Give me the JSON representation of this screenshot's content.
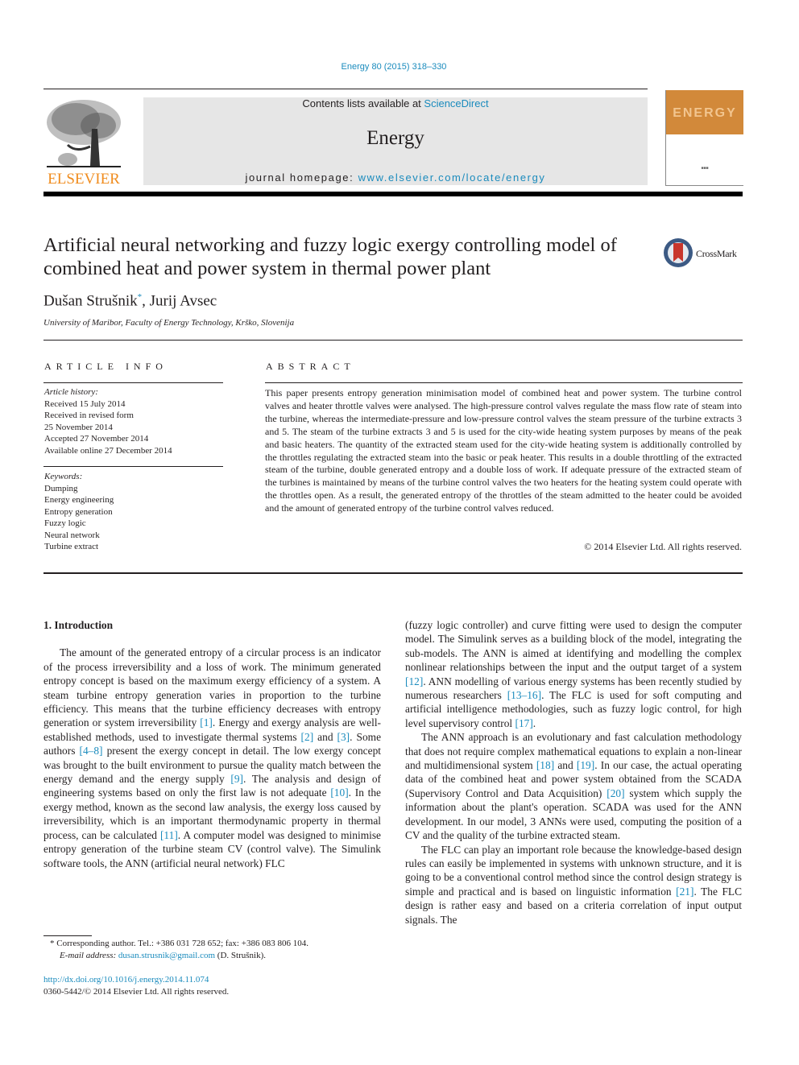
{
  "header": {
    "journal_reference": "Energy 80 (2015) 318–330",
    "publisher_logo_text": "ELSEVIER",
    "contents_prefix": "Contents lists available at ",
    "contents_link": "ScienceDirect",
    "journal_name": "Energy",
    "homepage_prefix": "journal homepage: ",
    "homepage_link": "www.elsevier.com/locate/energy",
    "cover_title": "ENERGY",
    "colors": {
      "link": "#1a8bbd",
      "elsevier_orange": "#f08c1e",
      "cover_orange": "#d2893a",
      "grey_box": "#e6e6e6"
    }
  },
  "article": {
    "title": "Artificial neural networking and fuzzy logic exergy controlling model of combined heat and power system in thermal power plant",
    "crossmark_label": "CrossMark",
    "authors": [
      {
        "name": "Dušan Strušnik",
        "mark": "*"
      },
      {
        "name": "Jurij Avsec",
        "mark": ""
      }
    ],
    "author_separator": ", ",
    "affiliation": "University of Maribor, Faculty of Energy Technology, Krško, Slovenija"
  },
  "article_info": {
    "heading": "ARTICLE INFO",
    "history_label": "Article history:",
    "history": [
      "Received 15 July 2014",
      "Received in revised form",
      "25 November 2014",
      "Accepted 27 November 2014",
      "Available online 27 December 2014"
    ],
    "keywords_label": "Keywords:",
    "keywords": [
      "Dumping",
      "Energy engineering",
      "Entropy generation",
      "Fuzzy logic",
      "Neural network",
      "Turbine extract"
    ]
  },
  "abstract": {
    "heading": "ABSTRACT",
    "text": "This paper presents entropy generation minimisation model of combined heat and power system. The turbine control valves and heater throttle valves were analysed. The high-pressure control valves regulate the mass flow rate of steam into the turbine, whereas the intermediate-pressure and low-pressure control valves the steam pressure of the turbine extracts 3 and 5. The steam of the turbine extracts 3 and 5 is used for the city-wide heating system purposes by means of the peak and basic heaters. The quantity of the extracted steam used for the city-wide heating system is additionally controlled by the throttles regulating the extracted steam into the basic or peak heater. This results in a double throttling of the extracted steam of the turbine, double generated entropy and a double loss of work. If adequate pressure of the extracted steam of the turbines is maintained by means of the turbine control valves the two heaters for the heating system could operate with the throttles open. As a result, the generated entropy of the throttles of the steam admitted to the heater could be avoided and the amount of generated entropy of the turbine control valves reduced.",
    "copyright": "© 2014 Elsevier Ltd. All rights reserved."
  },
  "introduction": {
    "heading": "1.  Introduction",
    "left_paragraphs": [
      [
        {
          "t": "The amount of the generated entropy of a circular process is an indicator of the process irreversibility and a loss of work. The minimum generated entropy concept is based on the maximum exergy efficiency of a system. A steam turbine entropy generation varies in proportion to the turbine efficiency. This means that the turbine efficiency decreases with entropy generation or system irreversibility "
        },
        {
          "ref": "[1]"
        },
        {
          "t": ". Energy and exergy analysis are well-established methods, used to investigate thermal systems "
        },
        {
          "ref": "[2]"
        },
        {
          "t": " and "
        },
        {
          "ref": "[3]"
        },
        {
          "t": ". Some authors "
        },
        {
          "ref": "[4–8]"
        },
        {
          "t": " present the exergy concept in detail. The low exergy concept was brought to the built environment to pursue the quality match between the energy demand and the energy supply "
        },
        {
          "ref": "[9]"
        },
        {
          "t": ". The analysis and design of engineering systems based on only the first law is not adequate "
        },
        {
          "ref": "[10]"
        },
        {
          "t": ". In the exergy method, known as the second law analysis, the exergy loss caused by irreversibility, which is an important thermodynamic property in thermal process, can be calculated "
        },
        {
          "ref": "[11]"
        },
        {
          "t": ". A computer model was designed to minimise entropy generation of the turbine steam CV (control valve). The Simulink software tools, the ANN (artificial neural network) FLC"
        }
      ]
    ],
    "right_paragraphs": [
      [
        {
          "t": "(fuzzy logic controller) and curve fitting were used to design the computer model. The Simulink serves as a building block of the model, integrating the sub-models. The ANN is aimed at identifying and modelling the complex nonlinear relationships between the input and the output target of a system "
        },
        {
          "ref": "[12]"
        },
        {
          "t": ". ANN modelling of various energy systems has been recently studied by numerous researchers "
        },
        {
          "ref": "[13–16]"
        },
        {
          "t": ". The FLC is used for soft computing and artificial intelligence methodologies, such as fuzzy logic control, for high level supervisory control "
        },
        {
          "ref": "[17]"
        },
        {
          "t": "."
        }
      ],
      [
        {
          "t": "The ANN approach is an evolutionary and fast calculation methodology that does not require complex mathematical equations to explain a non-linear and multidimensional system "
        },
        {
          "ref": "[18]"
        },
        {
          "t": " and "
        },
        {
          "ref": "[19]"
        },
        {
          "t": ". In our case, the actual operating data of the combined heat and power system obtained from the SCADA (Supervisory Control and Data Acquisition) "
        },
        {
          "ref": "[20]"
        },
        {
          "t": " system which supply the information about the plant's operation. SCADA was used for the ANN development. In our model, 3 ANNs were used, computing the position of a CV and the quality of the turbine extracted steam."
        }
      ],
      [
        {
          "t": "The FLC can play an important role because the knowledge-based design rules can easily be implemented in systems with unknown structure, and it is going to be a conventional control method since the control design strategy is simple and practical and is based on linguistic information "
        },
        {
          "ref": "[21]"
        },
        {
          "t": ". The FLC design is rather easy and based on a criteria correlation of input output signals. The"
        }
      ]
    ]
  },
  "footnotes": {
    "corresponding": "*  Corresponding author. Tel.: +386 031 728 652; fax: +386 083 806 104.",
    "email_label": "E-mail address: ",
    "email": "dusan.strusnik@gmail.com",
    "email_suffix": " (D. Strušnik).",
    "doi": "http://dx.doi.org/10.1016/j.energy.2014.11.074",
    "issn_copyright": "0360-5442/© 2014 Elsevier Ltd. All rights reserved."
  }
}
